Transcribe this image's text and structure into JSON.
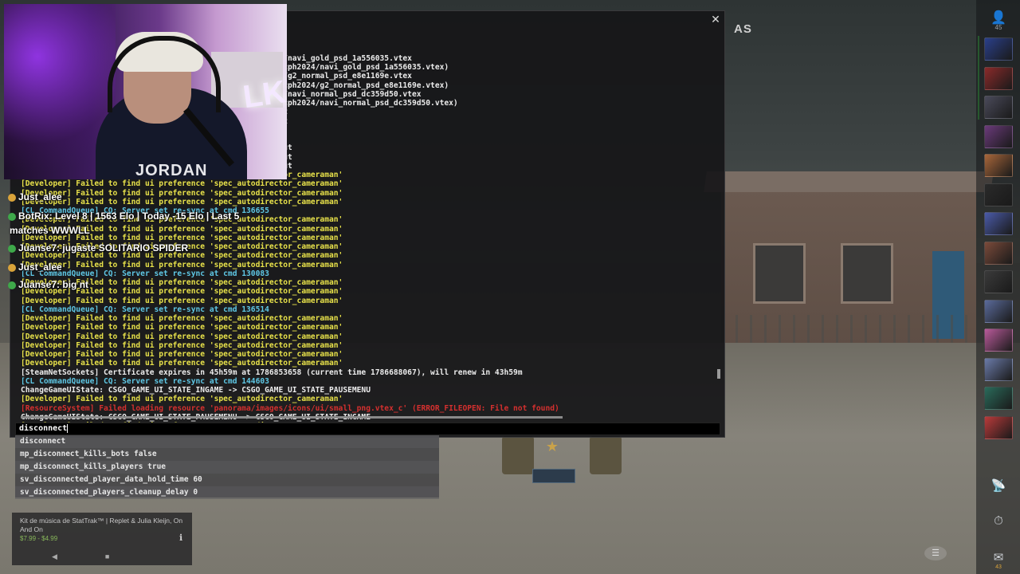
{
  "console": {
    "close_glyph": "✕",
    "partial_title": "AS",
    "lines": [
      {
        "text": "                                  ctor_cameraman'",
        "color": "yellow"
      },
      {
        "text": "                                  ctor_cameraman'",
        "color": "yellow"
      },
      {
        "text": "",
        "color": "white"
      },
      {
        "text": "                                  ed for stickers/cph2024/navi_gold_psd_1a556035.vtex",
        "color": "white"
      },
      {
        "text": "                                  ning request (stickers/cph2024/navi_gold_psd_1a556035.vtex)",
        "color": "white"
      },
      {
        "text": "                                  ed for stickers/cph2024/g2_normal_psd_e8e1169e.vtex",
        "color": "white"
      },
      {
        "text": "                                  ning request (stickers/cph2024/g2_normal_psd_e8e1169e.vtex)",
        "color": "white"
      },
      {
        "text": "                                  ed for stickers/cph2024/navi_normal_psd_dc359d50.vtex",
        "color": "white"
      },
      {
        "text": "                                  ning request (stickers/cph2024/navi_normal_psd_dc359d50.vtex)",
        "color": "white"
      },
      {
        "text": "                                  n a flowing right layout",
        "color": "white"
      },
      {
        "text": "                                  n a flowing right layout",
        "color": "white"
      },
      {
        "text": "",
        "color": "white"
      },
      {
        "text": "",
        "color": "white"
      },
      {
        "text": "                                  in a flowing right layout",
        "color": "white"
      },
      {
        "text": "                                  in a flowing right layout",
        "color": "white"
      },
      {
        "text": "                                  in a flowing right layout",
        "color": "white"
      },
      {
        "text": "[Developer] Failed to find ui preference 'spec_autodirector_cameraman'",
        "color": "yellow"
      },
      {
        "text": "[Developer] Failed to find ui preference 'spec_autodirector_cameraman'",
        "color": "yellow"
      },
      {
        "text": "[Developer] Failed to find ui preference 'spec_autodirector_cameraman'",
        "color": "yellow"
      },
      {
        "text": "[Developer] Failed to find ui preference 'spec_autodirector_cameraman'",
        "color": "yellow"
      },
      {
        "text": "[CL CommandQueue] CQ: Server set re-sync at cmd 136655",
        "color": "cyan"
      },
      {
        "text": "[Developer] Failed to find ui preference 'spec_autodirector_cameraman'",
        "color": "yellow"
      },
      {
        "text": "[Developer] Failed to find ui preference 'spec_autodirector_cameraman'",
        "color": "yellow"
      },
      {
        "text": "[Developer] Failed to find ui preference 'spec_autodirector_cameraman'",
        "color": "yellow"
      },
      {
        "text": "[Developer] Failed to find ui preference 'spec_autodirector_cameraman'",
        "color": "yellow"
      },
      {
        "text": "[Developer] Failed to find ui preference 'spec_autodirector_cameraman'",
        "color": "yellow"
      },
      {
        "text": "[Developer] Failed to find ui preference 'spec_autodirector_cameraman'",
        "color": "yellow"
      },
      {
        "text": "[CL CommandQueue] CQ: Server set re-sync at cmd 130083",
        "color": "cyan"
      },
      {
        "text": "[Developer] Failed to find ui preference 'spec_autodirector_cameraman'",
        "color": "yellow"
      },
      {
        "text": "[Developer] Failed to find ui preference 'spec_autodirector_cameraman'",
        "color": "yellow"
      },
      {
        "text": "[Developer] Failed to find ui preference 'spec_autodirector_cameraman'",
        "color": "yellow"
      },
      {
        "text": "[CL CommandQueue] CQ: Server set re-sync at cmd 136514",
        "color": "cyan"
      },
      {
        "text": "[Developer] Failed to find ui preference 'spec_autodirector_cameraman'",
        "color": "yellow"
      },
      {
        "text": "[Developer] Failed to find ui preference 'spec_autodirector_cameraman'",
        "color": "yellow"
      },
      {
        "text": "[Developer] Failed to find ui preference 'spec_autodirector_cameraman'",
        "color": "yellow"
      },
      {
        "text": "[Developer] Failed to find ui preference 'spec_autodirector_cameraman'",
        "color": "yellow"
      },
      {
        "text": "[Developer] Failed to find ui preference 'spec_autodirector_cameraman'",
        "color": "yellow"
      },
      {
        "text": "[Developer] Failed to find ui preference 'spec_autodirector_cameraman'",
        "color": "yellow"
      },
      {
        "text": "[SteamNetSockets] Certificate expires in 45h59m at 1786853658 (current time 1786688067), will renew in 43h59m",
        "color": "white"
      },
      {
        "text": "[CL CommandQueue] CQ: Server set re-sync at cmd 144603",
        "color": "cyan"
      },
      {
        "text": "ChangeGameUIState: CSGO_GAME_UI_STATE_INGAME -> CSGO_GAME_UI_STATE_PAUSEMENU",
        "color": "white"
      },
      {
        "text": "[Developer] Failed to find ui preference 'spec_autodirector_cameraman'",
        "color": "yellow"
      },
      {
        "text": "[ResourceSystem] Failed loading resource 'panorama/images/icons/ui/small_png.vtex_c' (ERROR_FILEOPEN: File not found)",
        "color": "red"
      },
      {
        "text": "ChangeGameUIState: CSGO_GAME_UI_STATE_PAUSEMENU -> CSGO_GAME_UI_STATE_INGAME",
        "color": "white"
      },
      {
        "text": "[Developer] Failed to find ui preference 'spec_autodirector_cameraman'",
        "color": "yellow"
      }
    ],
    "input_value": "disconnect",
    "suggestions": [
      "disconnect",
      "mp_disconnect_kills_bots false",
      "mp_disconnect_kills_players true",
      "sv_disconnected_player_data_hold_time 60",
      "sv_disconnected_players_cleanup_delay 0"
    ]
  },
  "webcam": {
    "shirt_text": "JORDAN",
    "neon_text": "LKZ"
  },
  "chat": [
    {
      "user": "Just_alee",
      "message": "",
      "badge_color": "#d9a33a"
    },
    {
      "user": "BotRix",
      "message": ": Level 8 | 1563 Elo | Today -15 Elo | Last 5",
      "badge_color": "#3ea84a"
    },
    {
      "user": "",
      "message": "matches WWWLL",
      "badge_color": ""
    },
    {
      "user": "Juanse7",
      "message": ": jugaste SOLITARIO SPIDER",
      "badge_color": "#3ea84a"
    },
    {
      "user": "Just_alee",
      "message": "",
      "badge_color": "#d9a33a"
    },
    {
      "user": "Juanse7",
      "message": ": big nt",
      "badge_color": "#3ea84a"
    }
  ],
  "store": {
    "title": "Kit de música de StatTrak™ | Replet & Julia Kleijn, On And On",
    "price": "$7.99 - $4.99",
    "icon": "ℹ"
  },
  "sidebar": {
    "top_icon": "👤",
    "top_count": "45",
    "friends_colors": [
      "#2a3f8a",
      "#8a2a2a",
      "#4a4a5a",
      "#6a3a7a",
      "#a8663a",
      "#2a2a2a",
      "#4a5aa8",
      "#7a4a3a",
      "#3a3a3a",
      "#5a6a9a",
      "#b85a9a",
      "#6a7aa8",
      "#2a6a5a",
      "#b83a3a"
    ],
    "bottom_icons": [
      {
        "glyph": "📡",
        "label": ""
      },
      {
        "glyph": "⏱",
        "label": ""
      },
      {
        "glyph": "✉",
        "label": "43"
      }
    ]
  }
}
